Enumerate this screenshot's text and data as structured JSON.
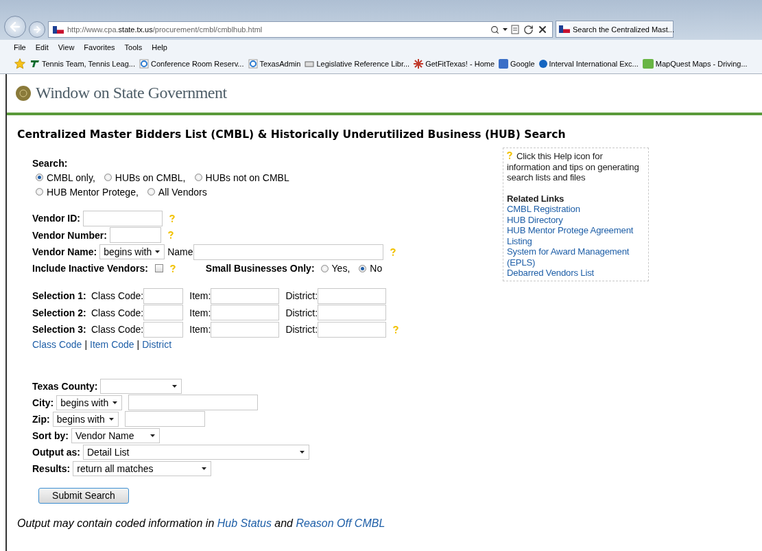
{
  "browser": {
    "address": "http://www.cpa.**state.tx.us**/procurement/cmbl/cmblhub.html",
    "tab_title": "Search the Centralized Mast...",
    "menu": [
      "File",
      "Edit",
      "View",
      "Favorites",
      "Tools",
      "Help"
    ],
    "favorites": [
      {
        "kind": "tp",
        "label": "Tennis Team, Tennis Leag..."
      },
      {
        "kind": "ie",
        "label": "Conference Room Reserv..."
      },
      {
        "kind": "ie",
        "label": "TexasAdmin"
      },
      {
        "kind": "lrl",
        "label": "Legislative Reference Libr..."
      },
      {
        "kind": "burst",
        "label": "GetFitTexas! - Home"
      },
      {
        "kind": "google",
        "label": "Google"
      },
      {
        "kind": "dot",
        "label": "Interval International  Exc..."
      },
      {
        "kind": "map",
        "label": "MapQuest Maps - Driving..."
      }
    ]
  },
  "site_title": "Window on State Government",
  "heading": "Centralized Master Bidders List (CMBL) & Historically Underutilized Business (HUB) Search",
  "search": {
    "label": "Search:",
    "rows": [
      [
        {
          "label": "CMBL only,",
          "selected": true
        },
        {
          "label": "HUBs on CMBL,",
          "selected": false
        },
        {
          "label": "HUBs not on CMBL",
          "selected": false
        }
      ],
      [
        {
          "label": "HUB Mentor Protege,",
          "selected": false
        },
        {
          "label": "All Vendors",
          "selected": false
        }
      ]
    ]
  },
  "vendor_id": {
    "label": "Vendor ID:"
  },
  "vendor_number": {
    "label": "Vendor Number:"
  },
  "vendor_name": {
    "label": "Vendor Name:",
    "match": "begins with",
    "name_label": "Name"
  },
  "inactive": {
    "label": "Include Inactive Vendors:",
    "checked": false
  },
  "small_business": {
    "label": "Small Businesses Only:",
    "options": [
      {
        "label": "Yes,",
        "selected": false
      },
      {
        "label": "No",
        "selected": true
      }
    ]
  },
  "selections": [
    {
      "label": "Selection 1:",
      "class_label": "Class Code:",
      "item_label": "Item:",
      "district_label": "District:"
    },
    {
      "label": "Selection 2:",
      "class_label": "Class Code:",
      "item_label": "Item:",
      "district_label": "District:"
    },
    {
      "label": "Selection 3:",
      "class_label": "Class Code:",
      "item_label": "Item:",
      "district_label": "District:"
    }
  ],
  "code_links": {
    "links": [
      "Class Code",
      "Item Code",
      "District"
    ],
    "separator": "|"
  },
  "county": {
    "label": "Texas County:"
  },
  "city": {
    "label": "City:",
    "match": "begins with"
  },
  "zip": {
    "label": "Zip:",
    "match": "begins with"
  },
  "sort_by": {
    "label": "Sort by:",
    "value": "Vendor Name"
  },
  "output_as": {
    "label": "Output as:",
    "value": "Detail List"
  },
  "results": {
    "label": "Results:",
    "value": "return all matches"
  },
  "submit": "Submit Search",
  "footnote": [
    {
      "kind": "text",
      "text": "Output may contain coded information in "
    },
    {
      "kind": "link",
      "text": "Hub Status"
    },
    {
      "kind": "text",
      "text": " and "
    },
    {
      "kind": "link",
      "text": "Reason Off CMBL"
    }
  ],
  "help_box": {
    "text": "Click this Help icon for information and tips on generating search lists and files",
    "related_title": "Related Links",
    "links": [
      "CMBL Registration",
      "HUB Directory",
      "HUB Mentor Protege Agreement Listing",
      "System for Award Management (EPLS)",
      "Debarred Vendors List"
    ]
  }
}
